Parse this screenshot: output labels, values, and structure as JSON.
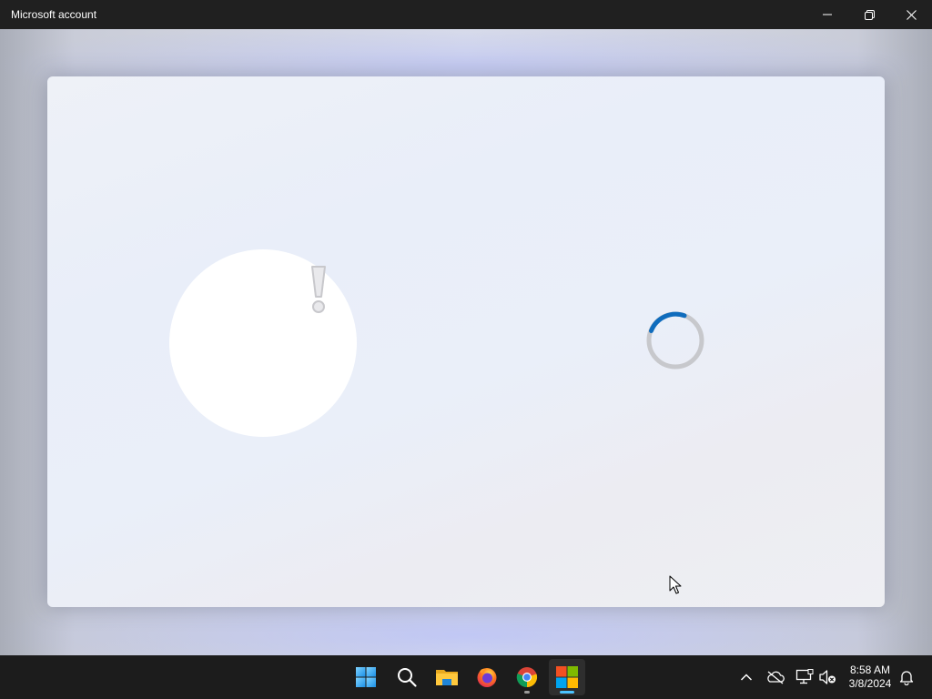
{
  "window": {
    "title": "Microsoft account",
    "controls": {
      "minimize_icon": "minimize-icon",
      "maximize_icon": "restore-icon",
      "close_icon": "close-icon"
    }
  },
  "content": {
    "status_icon": "exclamation-icon",
    "loading_indicator": "spinner-icon",
    "spinner_accent": "#0f6cbd"
  },
  "taskbar": {
    "apps": [
      {
        "name": "start",
        "icon": "windows-start-icon"
      },
      {
        "name": "search",
        "icon": "search-icon"
      },
      {
        "name": "file-explorer",
        "icon": "folder-icon"
      },
      {
        "name": "firefox",
        "icon": "firefox-icon"
      },
      {
        "name": "chrome",
        "icon": "chrome-icon",
        "running": true
      },
      {
        "name": "microsoft-store",
        "icon": "microsoft-store-icon",
        "active": true
      }
    ],
    "tray": {
      "icons": [
        "chevron-up-icon",
        "onedrive-offline-icon",
        "network-icon",
        "volume-muted-icon",
        "notification-bell-icon"
      ],
      "time": "8:58 AM",
      "date": "3/8/2024"
    },
    "accent": "#4cc2ff"
  }
}
